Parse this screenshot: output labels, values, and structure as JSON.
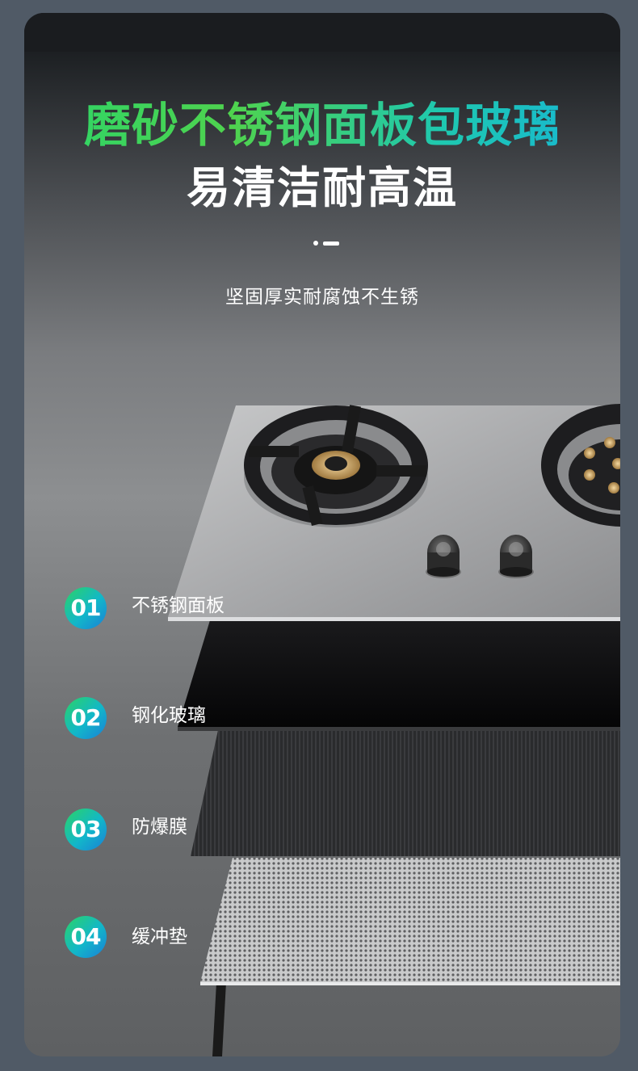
{
  "header": {
    "title": "磨砂不锈钢面板包玻璃",
    "subtitle": "易清洁耐高温",
    "description": "坚固厚实耐腐蚀不生锈"
  },
  "colors": {
    "title_gradient": [
      "#2ad46a",
      "#16b4d8"
    ],
    "badge_gradient": [
      "#2bd465",
      "#1a7fd6"
    ]
  },
  "layers": [
    {
      "number": "01",
      "label": "不锈钢面板"
    },
    {
      "number": "02",
      "label": "钢化玻璃"
    },
    {
      "number": "03",
      "label": "防爆膜"
    },
    {
      "number": "04",
      "label": "缓冲垫"
    }
  ]
}
